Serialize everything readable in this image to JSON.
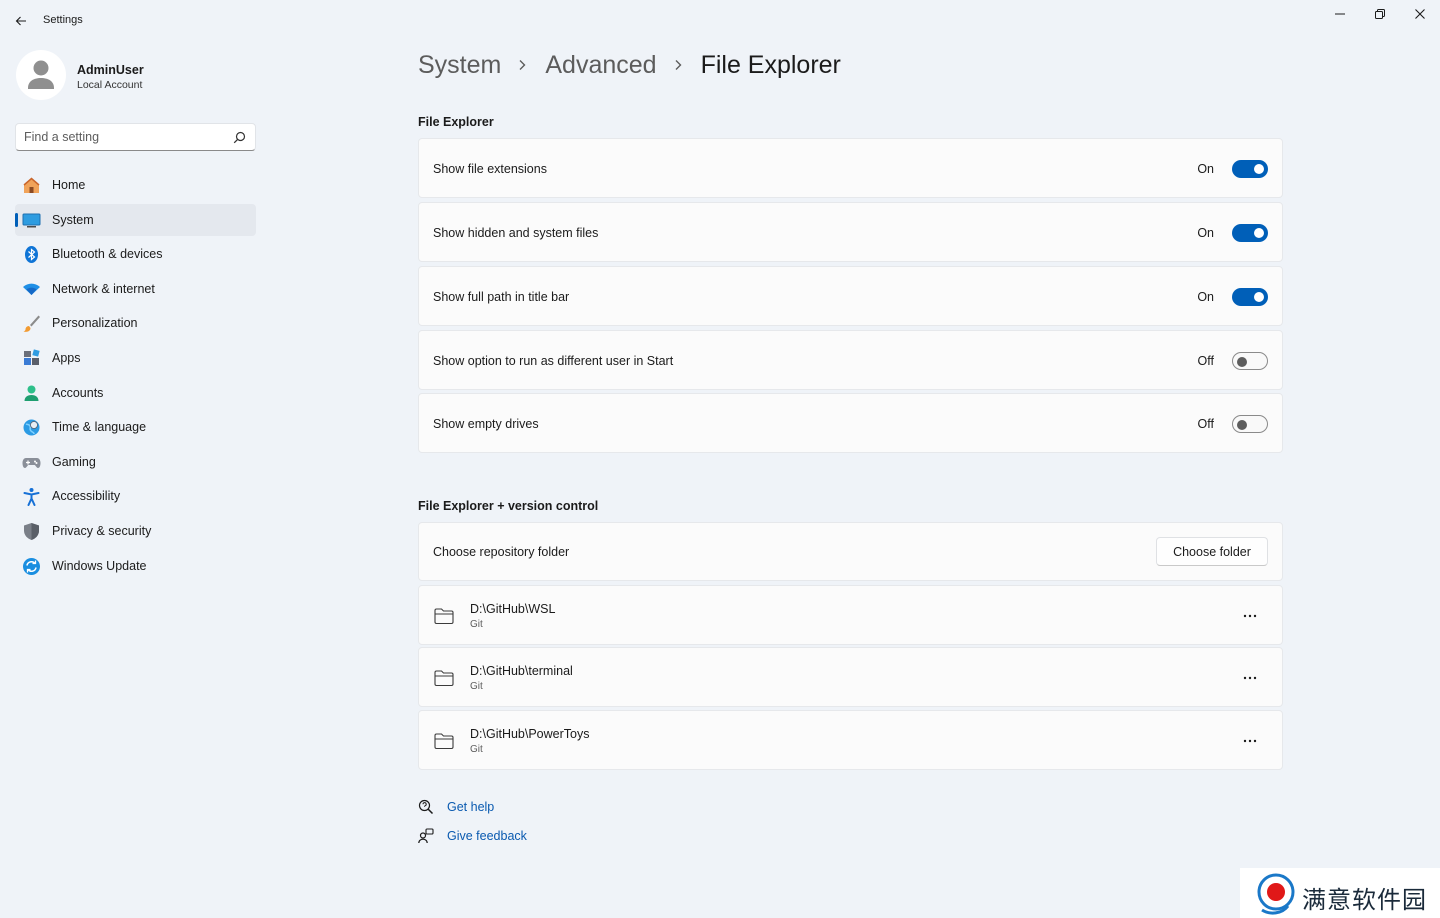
{
  "window": {
    "title": "Settings"
  },
  "profile": {
    "name": "AdminUser",
    "account_type": "Local Account"
  },
  "search": {
    "placeholder": "Find a setting"
  },
  "nav": {
    "items": [
      {
        "label": "Home",
        "icon": "home-icon"
      },
      {
        "label": "System",
        "icon": "system-icon",
        "active": true
      },
      {
        "label": "Bluetooth & devices",
        "icon": "bluetooth-icon"
      },
      {
        "label": "Network & internet",
        "icon": "wifi-icon"
      },
      {
        "label": "Personalization",
        "icon": "brush-icon"
      },
      {
        "label": "Apps",
        "icon": "apps-icon"
      },
      {
        "label": "Accounts",
        "icon": "accounts-icon"
      },
      {
        "label": "Time & language",
        "icon": "globe-icon"
      },
      {
        "label": "Gaming",
        "icon": "gamepad-icon"
      },
      {
        "label": "Accessibility",
        "icon": "accessibility-icon"
      },
      {
        "label": "Privacy & security",
        "icon": "shield-icon"
      },
      {
        "label": "Windows Update",
        "icon": "update-icon"
      }
    ]
  },
  "breadcrumb": {
    "level1": "System",
    "level2": "Advanced",
    "current": "File Explorer"
  },
  "file_explorer": {
    "title": "File Explorer",
    "settings": [
      {
        "label": "Show file extensions",
        "state": "On",
        "on": true
      },
      {
        "label": "Show hidden and system files",
        "state": "On",
        "on": true
      },
      {
        "label": "Show full path in title bar",
        "state": "On",
        "on": true
      },
      {
        "label": "Show option to run as different user in Start",
        "state": "Off",
        "on": false
      },
      {
        "label": "Show empty drives",
        "state": "Off",
        "on": false
      }
    ]
  },
  "version_control": {
    "title": "File Explorer + version control",
    "choose_label": "Choose repository folder",
    "choose_button": "Choose folder",
    "repos": [
      {
        "path": "D:\\GitHub\\WSL",
        "type": "Git"
      },
      {
        "path": "D:\\GitHub\\terminal",
        "type": "Git"
      },
      {
        "path": "D:\\GitHub\\PowerToys",
        "type": "Git"
      }
    ]
  },
  "help": {
    "get_help": "Get help",
    "give_feedback": "Give feedback"
  },
  "watermark": {
    "text": "满意软件园"
  },
  "colors": {
    "accent": "#005fb8",
    "link": "#0a5ab0",
    "background": "#eff3f8"
  }
}
